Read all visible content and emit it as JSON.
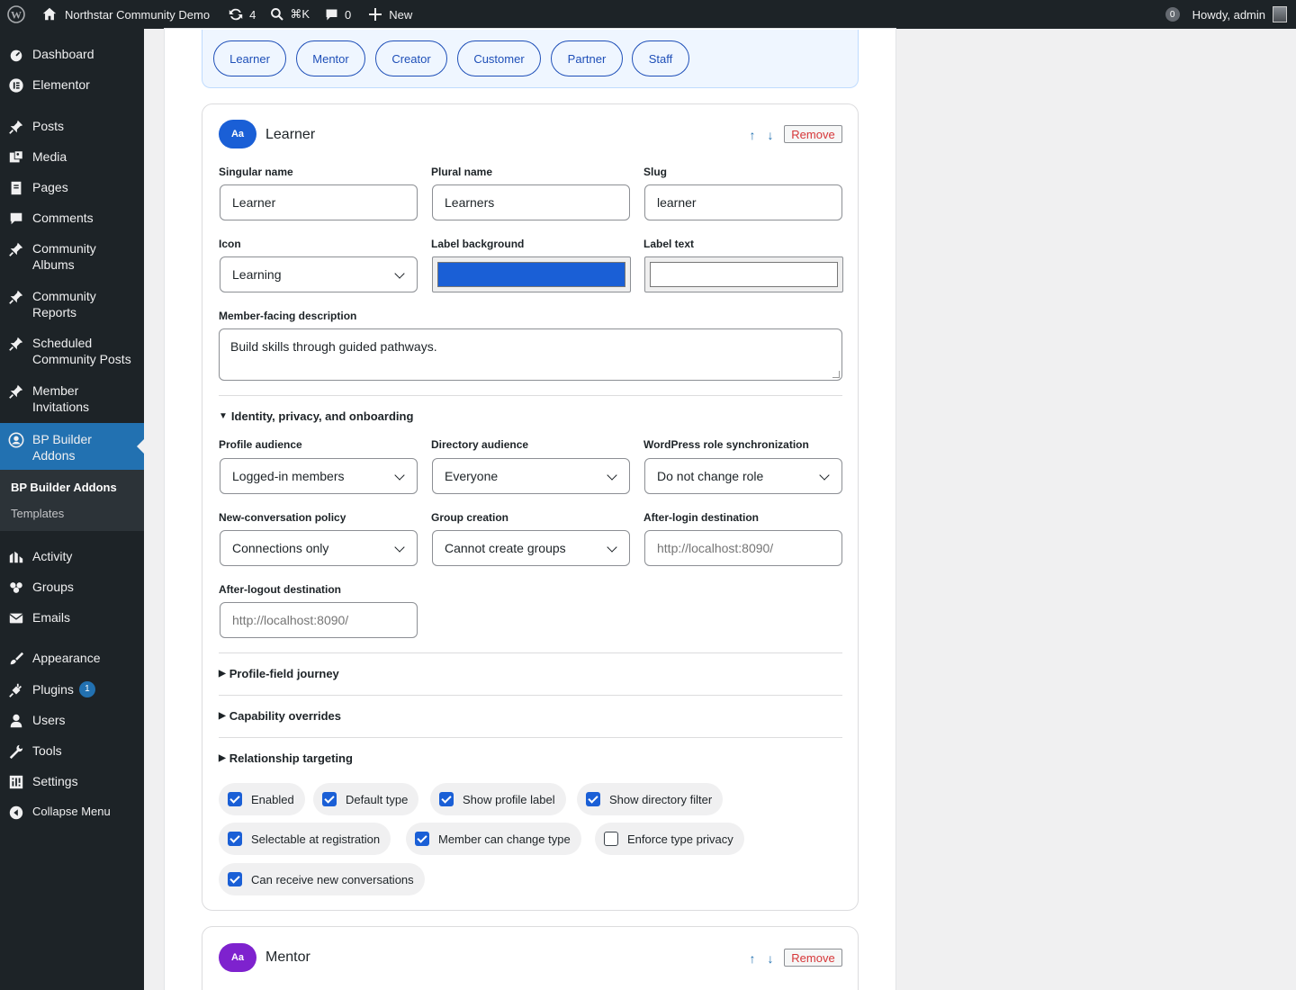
{
  "adminbar": {
    "site_name": "Northstar Community Demo",
    "updates_count": "4",
    "search_shortcut": "⌘K",
    "comments_count": "0",
    "new_label": "New",
    "notif_count": "0",
    "howdy": "Howdy, admin"
  },
  "sidebar": {
    "items": [
      {
        "label": "Dashboard",
        "icon": "dashboard-icon"
      },
      {
        "label": "Elementor",
        "icon": "elementor-icon"
      },
      {
        "label": "Posts",
        "icon": "pin-icon"
      },
      {
        "label": "Media",
        "icon": "media-icon"
      },
      {
        "label": "Pages",
        "icon": "pages-icon"
      },
      {
        "label": "Comments",
        "icon": "comment-icon"
      },
      {
        "label": "Community Albums",
        "icon": "pin-icon"
      },
      {
        "label": "Community Reports",
        "icon": "pin-icon"
      },
      {
        "label": "Scheduled Community Posts",
        "icon": "pin-icon"
      },
      {
        "label": "Member Invitations",
        "icon": "pin-icon"
      },
      {
        "label": "BP Builder Addons",
        "icon": "buddypress-icon"
      },
      {
        "label": "Activity",
        "icon": "activity-icon"
      },
      {
        "label": "Groups",
        "icon": "groups-icon"
      },
      {
        "label": "Emails",
        "icon": "email-icon"
      },
      {
        "label": "Appearance",
        "icon": "brush-icon"
      },
      {
        "label": "Plugins",
        "icon": "plugin-icon",
        "badge": "1"
      },
      {
        "label": "Users",
        "icon": "user-icon"
      },
      {
        "label": "Tools",
        "icon": "wrench-icon"
      },
      {
        "label": "Settings",
        "icon": "settings-icon"
      },
      {
        "label": "Collapse Menu",
        "icon": "collapse-icon"
      }
    ],
    "submenu": [
      "BP Builder Addons",
      "Templates"
    ]
  },
  "type_tabs": [
    "Learner",
    "Mentor",
    "Creator",
    "Customer",
    "Partner",
    "Staff"
  ],
  "learner_card": {
    "badge": "Aa",
    "title": "Learner",
    "remove": "Remove",
    "fields": {
      "singular_label": "Singular name",
      "singular_value": "Learner",
      "plural_label": "Plural name",
      "plural_value": "Learners",
      "slug_label": "Slug",
      "slug_value": "learner",
      "icon_label": "Icon",
      "icon_value": "Learning",
      "bg_label": "Label background",
      "bg_color": "#1a5fd6",
      "text_label": "Label text",
      "text_color": "#ffffff",
      "desc_label": "Member-facing description",
      "desc_value": "Build skills through guided pathways."
    },
    "identity": {
      "summary": "Identity, privacy, and onboarding",
      "profile_audience_label": "Profile audience",
      "profile_audience_value": "Logged-in members",
      "directory_audience_label": "Directory audience",
      "directory_audience_value": "Everyone",
      "role_sync_label": "WordPress role synchronization",
      "role_sync_value": "Do not change role",
      "conversation_label": "New-conversation policy",
      "conversation_value": "Connections only",
      "group_label": "Group creation",
      "group_value": "Cannot create groups",
      "login_label": "After-login destination",
      "login_placeholder": "http://localhost:8090/",
      "logout_label": "After-logout destination",
      "logout_placeholder": "http://localhost:8090/"
    },
    "sections": [
      "Profile-field journey",
      "Capability overrides",
      "Relationship targeting"
    ],
    "checkboxes": [
      {
        "label": "Enabled",
        "checked": true
      },
      {
        "label": "Default type",
        "checked": true
      },
      {
        "label": "Show profile label",
        "checked": true
      },
      {
        "label": "Show directory filter",
        "checked": true
      },
      {
        "label": "Selectable at registration",
        "checked": true
      },
      {
        "label": "Member can change type",
        "checked": true
      },
      {
        "label": "Enforce type privacy",
        "checked": false
      },
      {
        "label": "Can receive new conversations",
        "checked": true
      }
    ]
  },
  "mentor_card": {
    "badge": "Aa",
    "title": "Mentor",
    "remove": "Remove"
  },
  "colors": {
    "learner_badge": "#1a5fd6",
    "mentor_badge": "#7e22ce",
    "accent": "#2271b1"
  }
}
